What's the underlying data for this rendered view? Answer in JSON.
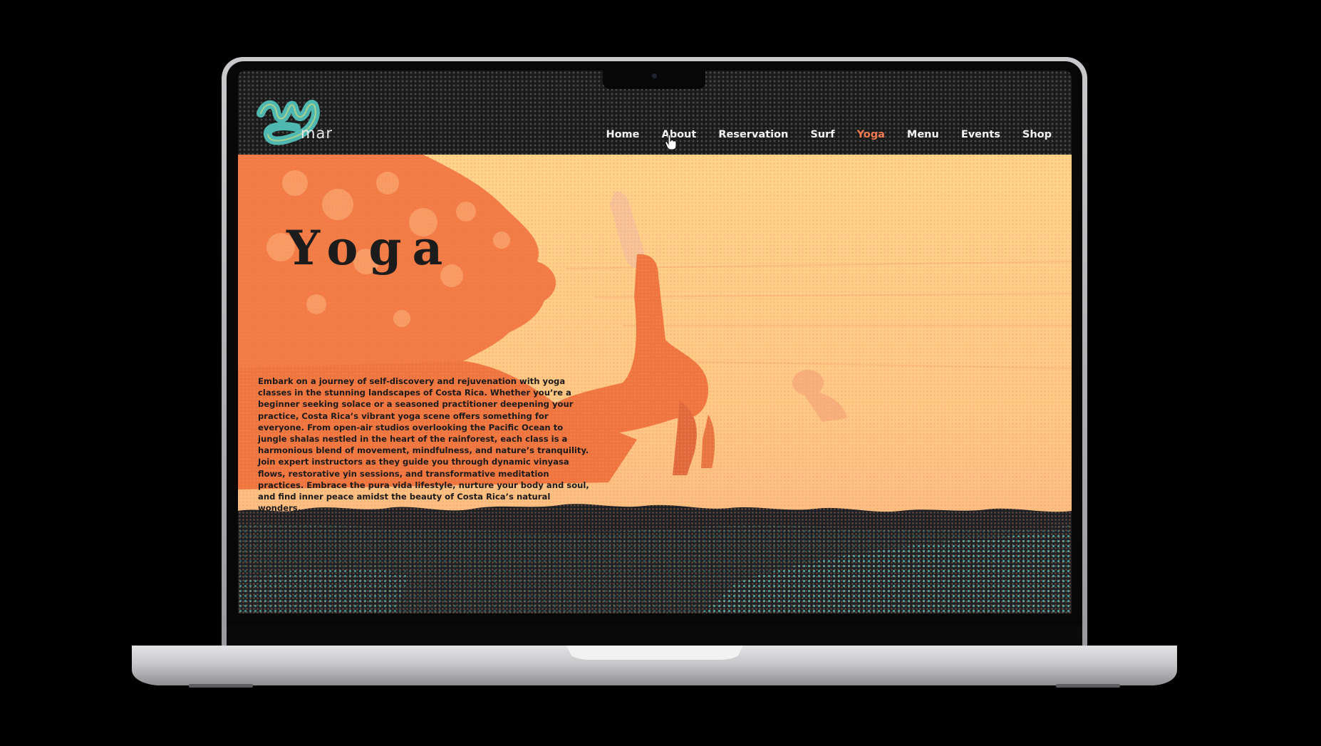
{
  "site": {
    "logo_text": "mar",
    "brand_colors": {
      "teal": "#4fb8b0",
      "orange": "#ef7a4f",
      "sand": "#ffd58c",
      "dark": "#1a1a1a"
    }
  },
  "nav": {
    "items": [
      {
        "label": "Home",
        "active": false
      },
      {
        "label": "About",
        "active": false
      },
      {
        "label": "Reservation",
        "active": false
      },
      {
        "label": "Surf",
        "active": false
      },
      {
        "label": "Yoga",
        "active": true
      },
      {
        "label": "Menu",
        "active": false
      },
      {
        "label": "Events",
        "active": false
      },
      {
        "label": "Shop",
        "active": false
      }
    ]
  },
  "hero": {
    "title": "Yoga",
    "description": "Embark on a journey of self-discovery and rejuvenation with yoga classes in the stunning landscapes of Costa Rica. Whether you’re a beginner seeking solace or a seasoned practitioner deepening your practice, Costa Rica’s vibrant yoga scene offers something for everyone. From open-air studios overlooking the Pacific Ocean to jungle shalas nestled in the heart of the rainforest, each class is a harmonious blend of movement, mindfulness, and nature’s tranquility. Join expert instructors as they guide you through dynamic vinyasa flows, restorative yin sessions, and transformative meditation practices. Embrace the pura vida lifestyle, nurture your body and soul, and find inner peace amidst the beauty of Costa Rica’s natural wonders."
  }
}
